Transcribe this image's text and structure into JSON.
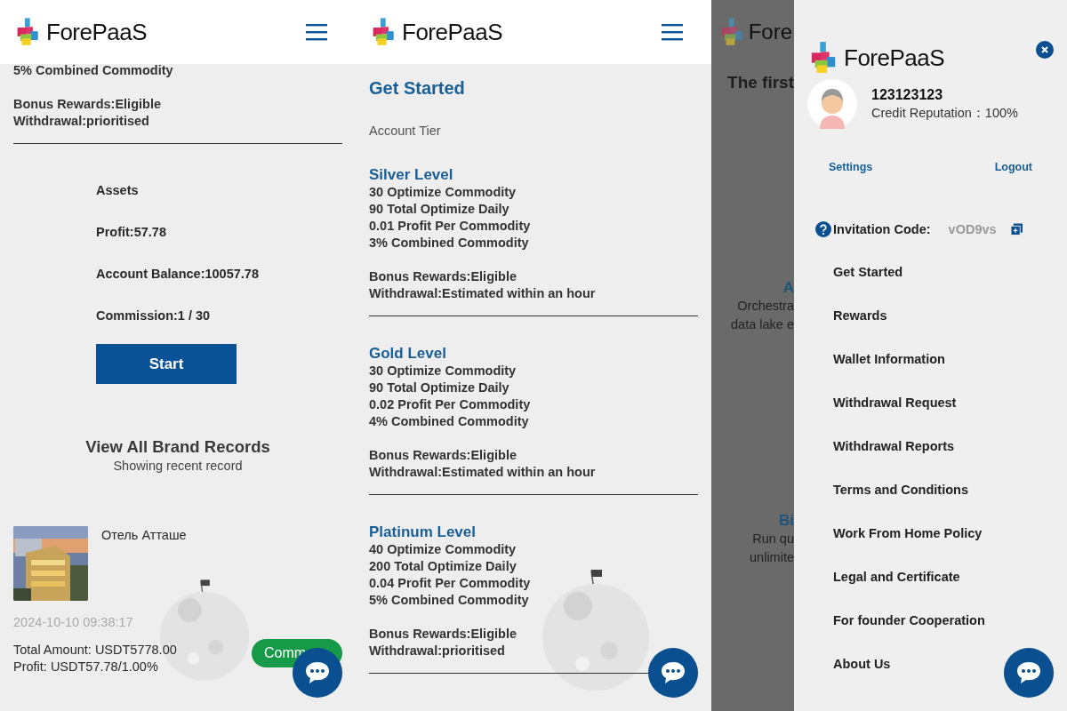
{
  "home": {
    "logo": "ForePaaS",
    "tier_tail": [
      "5% Combined Commodity"
    ],
    "perks": [
      "Bonus Rewards:Eligible",
      "Withdrawal:prioritised"
    ],
    "assets": {
      "title": "Assets",
      "lines": [
        "Profit:57.78",
        "Account Balance:10057.78",
        "Commission:1 / 30"
      ]
    },
    "start_button": "Start",
    "records": {
      "title": "View All Brand Records",
      "subtitle": "Showing recent record",
      "items": [
        {
          "kind": "picture",
          "title": "Отель Атташе",
          "date": "2024-10-10 09:38:17",
          "total": "Total Amount:  USDT5778.00",
          "profit": "Profit:  USDT57.78/1.00%",
          "action": "Comm"
        }
      ]
    }
  },
  "tiers_page": {
    "logo": "ForePaaS",
    "title": "Get Started",
    "subtitle": "Account Tier",
    "levels": [
      {
        "name": "Silver Level",
        "features": [
          "30 Optimize Commodity",
          "90 Total Optimize Daily",
          "0.01 Profit Per Commodity",
          "3% Combined Commodity"
        ],
        "perks": [
          "Bonus Rewards:Eligible",
          "Withdrawal:Estimated within an hour"
        ]
      },
      {
        "name": "Gold Level",
        "features": [
          "30 Optimize Commodity",
          "90 Total Optimize Daily",
          "0.02 Profit Per Commodity",
          "4% Combined Commodity"
        ],
        "perks": [
          "Bonus Rewards:Eligible",
          "Withdrawal:Estimated within an hour"
        ]
      },
      {
        "name": "Platinum Level",
        "features": [
          "40 Optimize Commodity",
          "200 Total Optimize Daily",
          "0.04 Profit Per Commodity",
          "5% Combined Commodity"
        ],
        "perks": [
          "Bonus Rewards:Eligible",
          "Withdrawal:prioritised"
        ]
      }
    ]
  },
  "menu_page": {
    "background": {
      "logo": "Fore",
      "heading": "The first",
      "features": [
        {
          "title": "A",
          "body": [
            "Orchestra",
            "data lake e"
          ]
        },
        {
          "title": "Bi",
          "body": [
            "Run qu",
            "unlimite"
          ]
        }
      ]
    },
    "drawer": {
      "logo": "ForePaaS",
      "user": {
        "id": "123123123",
        "credit": "Credit Reputation：100%"
      },
      "links": [
        "Settings",
        "Logout"
      ],
      "invitation": {
        "label": "Invitation Code:",
        "code": "vOD9vs"
      },
      "menu": [
        "Get Started",
        "Rewards",
        "Wallet Information",
        "Withdrawal Request",
        "Withdrawal Reports",
        "Terms and Conditions",
        "Work From Home Policy",
        "Legal and Certificate",
        "For founder Cooperation",
        "About Us"
      ]
    }
  }
}
